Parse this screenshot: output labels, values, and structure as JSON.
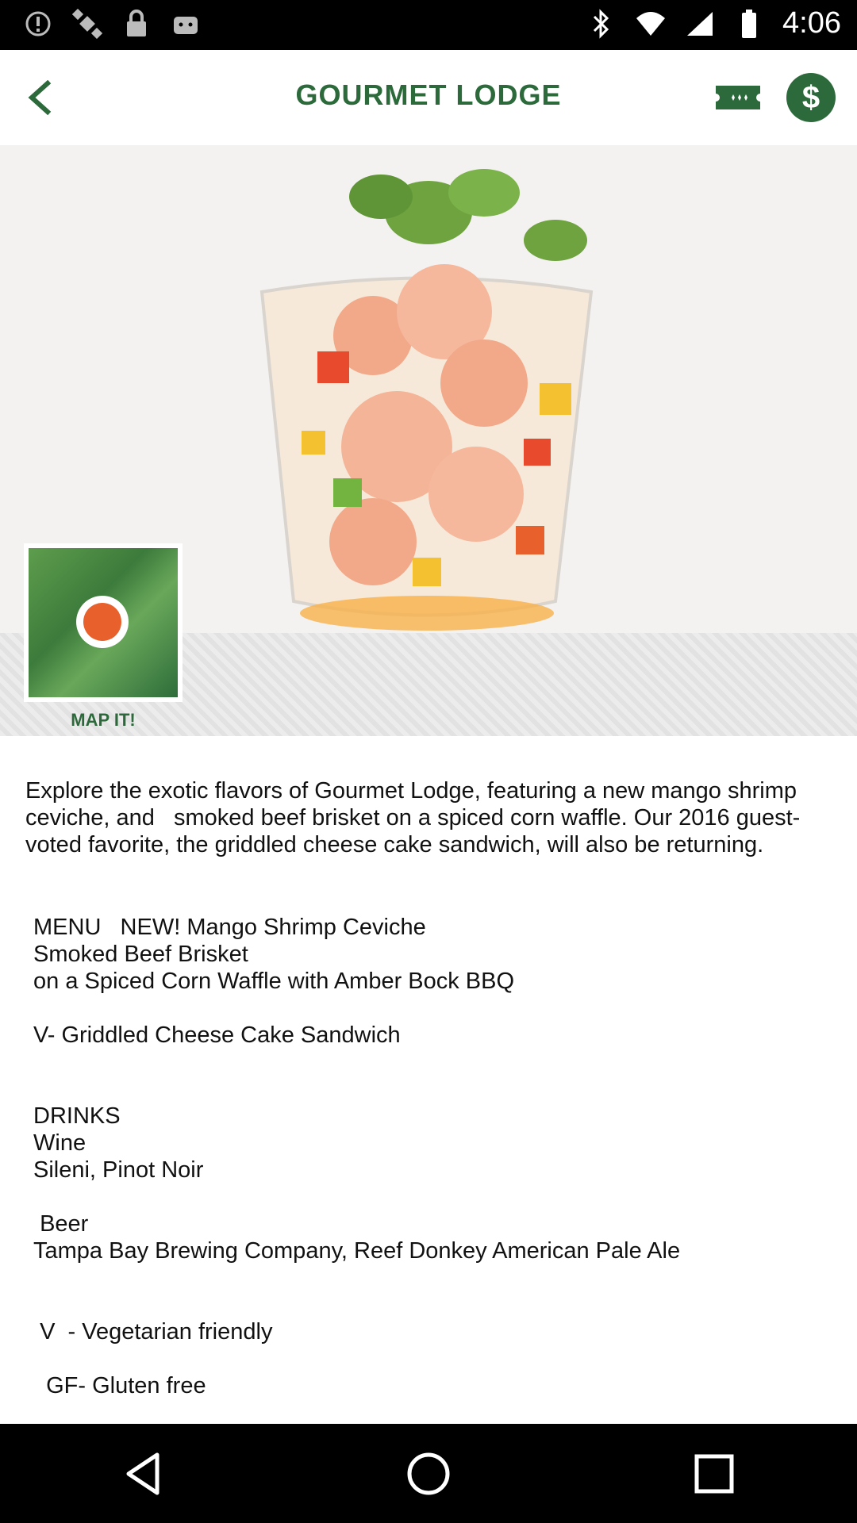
{
  "status_bar": {
    "time": "4:06",
    "left_icons": [
      "alert-icon",
      "satellite-icon",
      "lock-icon",
      "android-icon"
    ],
    "right_icons": [
      "bluetooth-icon",
      "wifi-icon",
      "signal-icon",
      "battery-icon"
    ]
  },
  "header": {
    "title": "GOURMET LODGE",
    "icons": [
      "back-arrow-icon",
      "ticket-icon",
      "dollar-icon"
    ]
  },
  "hero": {
    "map_label": "MAP IT!"
  },
  "content": {
    "description": "Explore the exotic flavors of Gourmet Lodge, featuring a new mango shrimp ceviche, and   smoked beef brisket on a spiced corn waffle. Our 2016 guest-voted favorite, the griddled cheese cake sandwich, will also be returning.",
    "menu_block": "MENU   NEW! Mango Shrimp Ceviche\nSmoked Beef Brisket\non a Spiced Corn Waffle with Amber Bock BBQ\n\nV- Griddled Cheese Cake Sandwich\n\n\nDRINKS\nWine\nSileni, Pinot Noir\n\n Beer\nTampa Bay Brewing Company, Reef Donkey American Pale Ale\n\n\n V  - Vegetarian friendly\n\n  GF- Gluten free"
  },
  "colors": {
    "accent": "#2d6a3b",
    "pin": "#e8602b"
  }
}
